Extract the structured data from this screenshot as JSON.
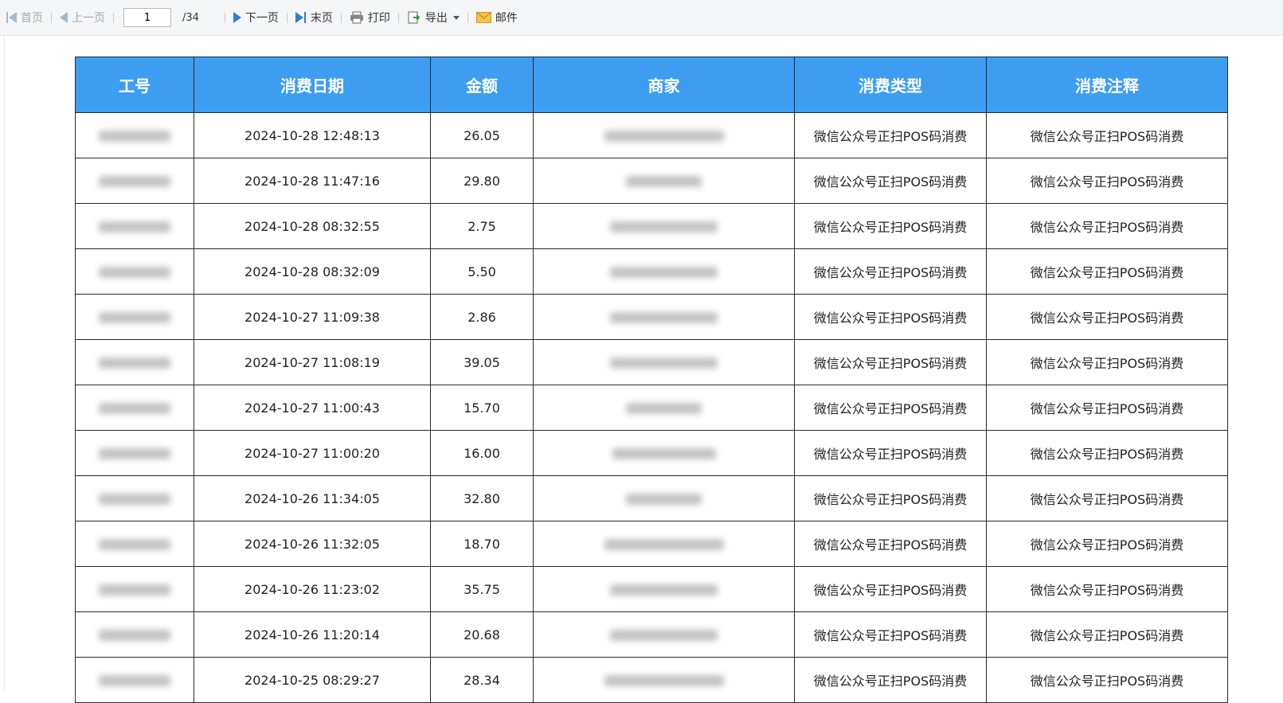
{
  "toolbar": {
    "first_label": "首页",
    "prev_label": "上一页",
    "current_page": "1",
    "total_pages": "/34",
    "next_label": "下一页",
    "last_label": "末页",
    "print_label": "打印",
    "export_label": "导出",
    "mail_label": "邮件",
    "accent_color": "#2f7fd2",
    "disabled_color": "#9fbad6"
  },
  "table": {
    "header_color": "#3d9ef1",
    "columns": [
      "工号",
      "消费日期",
      "金额",
      "商家",
      "消费类型",
      "消费注释"
    ],
    "rows": [
      {
        "date": "2024-10-28 12:48:13",
        "amount": "26.05",
        "type": "微信公众号正扫POS码消费",
        "note": "微信公众号正扫POS码消费"
      },
      {
        "date": "2024-10-28 11:47:16",
        "amount": "29.80",
        "type": "微信公众号正扫POS码消费",
        "note": "微信公众号正扫POS码消费"
      },
      {
        "date": "2024-10-28 08:32:55",
        "amount": "2.75",
        "type": "微信公众号正扫POS码消费",
        "note": "微信公众号正扫POS码消费"
      },
      {
        "date": "2024-10-28 08:32:09",
        "amount": "5.50",
        "type": "微信公众号正扫POS码消费",
        "note": "微信公众号正扫POS码消费"
      },
      {
        "date": "2024-10-27 11:09:38",
        "amount": "2.86",
        "type": "微信公众号正扫POS码消费",
        "note": "微信公众号正扫POS码消费"
      },
      {
        "date": "2024-10-27 11:08:19",
        "amount": "39.05",
        "type": "微信公众号正扫POS码消费",
        "note": "微信公众号正扫POS码消费"
      },
      {
        "date": "2024-10-27 11:00:43",
        "amount": "15.70",
        "type": "微信公众号正扫POS码消费",
        "note": "微信公众号正扫POS码消费"
      },
      {
        "date": "2024-10-27 11:00:20",
        "amount": "16.00",
        "type": "微信公众号正扫POS码消费",
        "note": "微信公众号正扫POS码消费"
      },
      {
        "date": "2024-10-26 11:34:05",
        "amount": "32.80",
        "type": "微信公众号正扫POS码消费",
        "note": "微信公众号正扫POS码消费"
      },
      {
        "date": "2024-10-26 11:32:05",
        "amount": "18.70",
        "type": "微信公众号正扫POS码消费",
        "note": "微信公众号正扫POS码消费"
      },
      {
        "date": "2024-10-26 11:23:02",
        "amount": "35.75",
        "type": "微信公众号正扫POS码消费",
        "note": "微信公众号正扫POS码消费"
      },
      {
        "date": "2024-10-26 11:20:14",
        "amount": "20.68",
        "type": "微信公众号正扫POS码消费",
        "note": "微信公众号正扫POS码消费"
      },
      {
        "date": "2024-10-25 08:29:27",
        "amount": "28.34",
        "type": "微信公众号正扫POS码消费",
        "note": "微信公众号正扫POS码消费"
      }
    ]
  }
}
